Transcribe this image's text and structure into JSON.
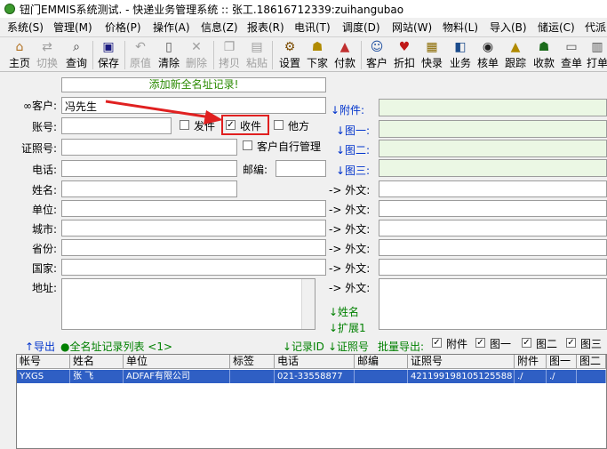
{
  "window": {
    "title": "钮门EMMIS系统测试. - 快递业务管理系统 :: 张工.18616712339:zuihangubao"
  },
  "menu": [
    "系统(S)",
    "管理(M)",
    "价格(P)",
    "操作(A)",
    "信息(Z)",
    "报表(R)",
    "电讯(T)",
    "调度(D)",
    "网站(W)",
    "物料(L)",
    "导入(B)",
    "储运(C)",
    "代派"
  ],
  "toolbar": {
    "home": "主页",
    "switch": "切换",
    "query": "查询",
    "save": "保存",
    "original": "原值",
    "clear": "清除",
    "delete": "删除",
    "copy": "拷贝",
    "paste": "粘贴",
    "settings": "设置",
    "next": "下家",
    "payment": "付款",
    "customer": "客户",
    "discount": "折扣",
    "quickform": "快录",
    "business": "业务",
    "verify": "核单",
    "track": "跟踪",
    "receive": "收款",
    "lookup": "查单",
    "print": "打单"
  },
  "form": {
    "banner": "添加新全名址记录!",
    "customer_label": "∞客户:",
    "customer_value": "冯先生",
    "account_label": "账号:",
    "license_label": "证照号:",
    "phone_label": "电话:",
    "name_label": "姓名:",
    "unit_label": "单位:",
    "city_label": "城市:",
    "province_label": "省份:",
    "country_label": "国家:",
    "address_label": "地址:",
    "sender_label": "发件",
    "receiver_label": "收件",
    "other_label": "他方",
    "self_manage_label": "客户自行管理",
    "postcode_label": "邮编:",
    "attachment_label": "↓附件:",
    "pic1_label": "↓图一:",
    "pic2_label": "↓图二:",
    "pic3_label": "↓图三:",
    "foreign_label": "-> 外文:",
    "name_link": "↓姓名",
    "extend_link": "↓扩展1"
  },
  "bottom_bar": {
    "export": "↑导出",
    "list_title": "●全名址记录列表 <1>",
    "record_id": "↓记录ID",
    "license_no": "↓证照号",
    "batch_export": "批量导出:",
    "opt_attachment": "附件",
    "opt_pic1": "图一",
    "opt_pic2": "图二",
    "opt_pic3": "图三"
  },
  "table": {
    "headers": [
      "帐号",
      "姓名",
      "单位",
      "标签",
      "电话",
      "邮编",
      "证照号",
      "附件",
      "图一",
      "图二"
    ],
    "rows": [
      [
        "YXGS",
        "张 飞",
        "ADFAF有限公司",
        "",
        "021-33558877",
        "",
        "421199198105125588",
        "./",
        "./",
        ""
      ]
    ]
  }
}
